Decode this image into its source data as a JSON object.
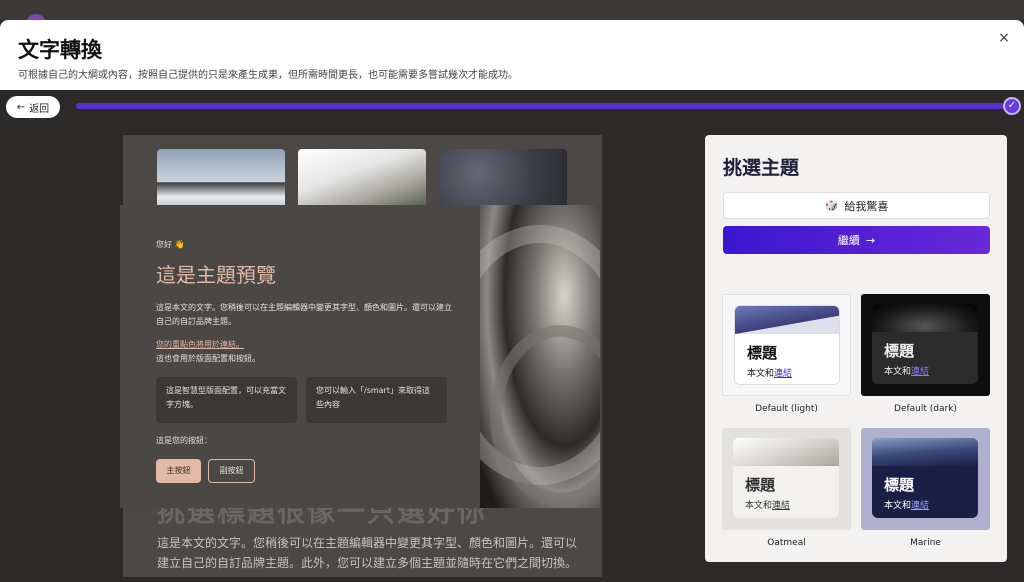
{
  "modal": {
    "title": "文字轉換",
    "subtitle": "可根據自己的大綱或內容，按照自己提供的只是來產生成果，但所需時間更長，也可能需要多嘗試幾次才能成功。",
    "close_icon": "×"
  },
  "progress": {
    "back_label": "返回",
    "back_icon": "←",
    "fraction": 1.0,
    "check_icon": "✓"
  },
  "preview": {
    "bg_heading": "挑選標題很像一只選好你",
    "bg_body": "這是本文的文字。您稍後可以在主題編輯器中變更其字型、顏色和圖片。還可以建立自己的自訂品牌主題。此外，您可以建立多個主題並隨時在它們之間切換。",
    "greeting": "您好 👋",
    "title": "這是主題預覽",
    "paragraph": "這是本文的文字。您稍後可以在主題編輯器中變更其字型、顏色和圖片。還可以建立自己的自訂品牌主題。",
    "link_text": "您的重點色將用於連結。",
    "link_after": "這也會用於版面配置和按鈕。",
    "box1": "這是智慧型版面配置，可以充當文字方塊。",
    "box2": "您可以輸入「/smart」來取得這些內容",
    "buttons_label": "這是您的按鈕：",
    "primary_button": "主按鈕",
    "secondary_button": "副按鈕"
  },
  "theme_panel": {
    "title": "挑選主題",
    "surprise_label": "給我驚喜",
    "surprise_icon": "🎲",
    "continue_label": "繼續",
    "continue_icon": "→",
    "tile_heading": "標題",
    "tile_body_prefix": "本文和",
    "tile_body_link": "連結",
    "themes": [
      {
        "name": "Default (light)"
      },
      {
        "name": "Default (dark)"
      },
      {
        "name": "Oatmeal"
      },
      {
        "name": "Marine"
      }
    ]
  }
}
